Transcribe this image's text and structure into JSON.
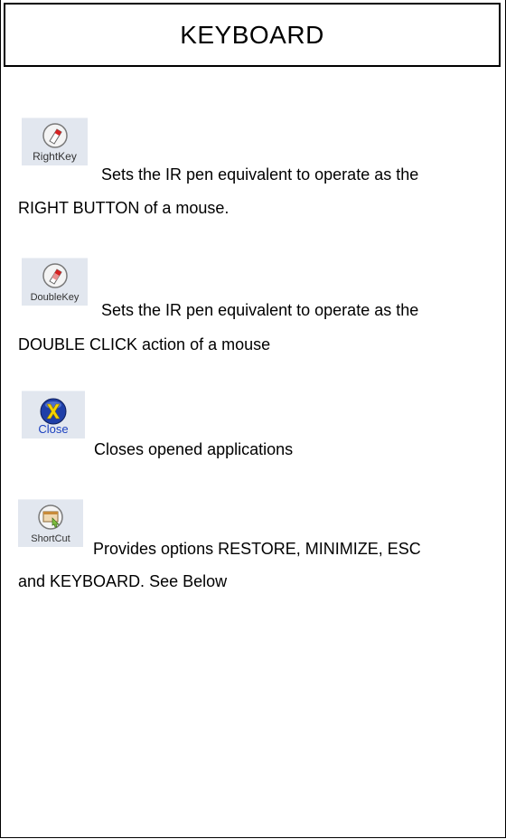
{
  "title": "KEYBOARD",
  "entries": [
    {
      "icon": "right-key-mouse-icon",
      "caption": "RightKey",
      "line1": "Sets the IR pen equivalent to operate as the",
      "line2": "RIGHT BUTTON of a mouse."
    },
    {
      "icon": "double-key-mouse-icon",
      "caption": "DoubleKey",
      "line1": "Sets the IR pen equivalent to operate as the",
      "line2": "DOUBLE CLICK action of a mouse"
    },
    {
      "icon": "close-x-icon",
      "caption": "Close",
      "line1": "Closes opened applications",
      "line2": ""
    },
    {
      "icon": "shortcut-icon",
      "caption": "ShortCut",
      "line1": "Provides options RESTORE, MINIMIZE, ESC",
      "line2": "and KEYBOARD. See Below"
    }
  ],
  "colors": {
    "tile_background": "#e2e7ef",
    "close_caption": "#1a3fbf",
    "close_icon_blue": "#1f3fa8",
    "close_icon_yellow": "#f5d400"
  }
}
